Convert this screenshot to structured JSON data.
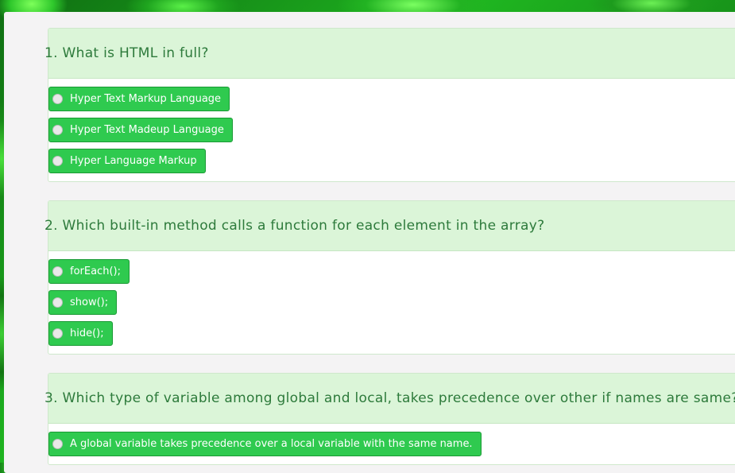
{
  "questions": [
    {
      "number": "1.",
      "text": "1. What is HTML in full?",
      "options": [
        "Hyper Text Markup Language",
        "Hyper Text Madeup Language",
        "Hyper Language Markup"
      ]
    },
    {
      "number": "2.",
      "text": "2. Which built-in method calls a function for each element in the array?",
      "options": [
        "forEach();",
        "show();",
        "hide();"
      ]
    },
    {
      "number": "3.",
      "text": "3. Which type of variable among global and local, takes precedence over other if names are same?",
      "options": [
        "A global variable takes precedence over a local variable with the same name."
      ]
    }
  ],
  "colors": {
    "option_bg": "#2fca4f",
    "question_header_bg": "#dbf5d8",
    "question_text": "#2d7a3b",
    "panel_bg": "#f4f3f4"
  }
}
